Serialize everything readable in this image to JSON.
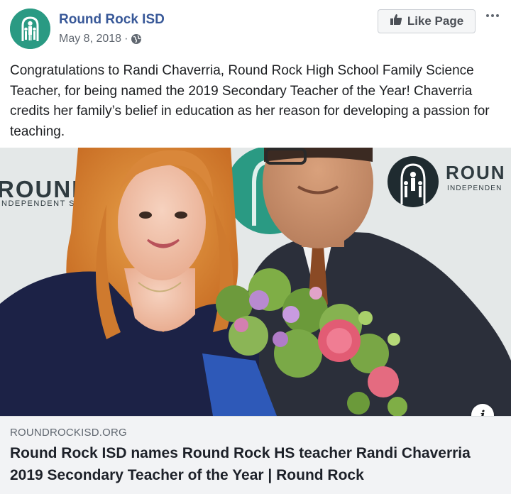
{
  "post": {
    "page_name": "Round Rock ISD",
    "date": "May 8, 2018",
    "separator": "·",
    "like_button_label": "Like Page",
    "text": "Congratulations to Randi Chaverria, Round Rock High School Family Science Teacher, for being named the 2019 Secondary Teacher of the Year! Chaverria credits her family’s belief in education as her reason for developing a passion for teaching."
  },
  "photo": {
    "banner_left_line1": "ROUND",
    "banner_left_line2": "NDEPENDENT SC",
    "banner_right_line1": "ROUN",
    "banner_right_line2": "INDEPENDEN"
  },
  "link_card": {
    "domain": "ROUNDROCKISD.ORG",
    "title": "Round Rock ISD names Round Rock HS teacher Randi Chaverria 2019 Secondary Teacher of the Year | Round Rock"
  },
  "colors": {
    "brand_teal": "#2a9a83",
    "page_name_blue": "#385898"
  },
  "icons": {
    "avatar": "round-rock-isd-logo",
    "privacy": "globe-icon",
    "like": "thumbs-up-icon",
    "more": "more-options-icon",
    "info": "info-icon"
  }
}
